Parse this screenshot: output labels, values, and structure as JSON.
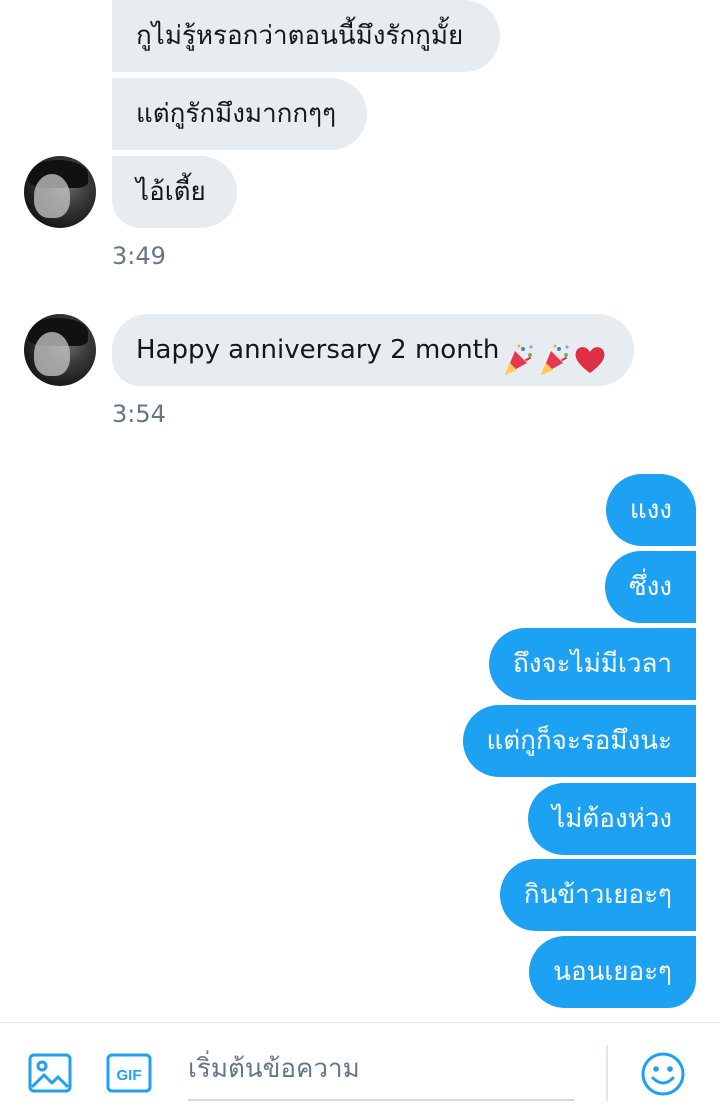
{
  "messages": {
    "incoming": [
      {
        "text": "กูไม่รู้หรอกว่าตอนนี้มึงรักกูมั้ย"
      },
      {
        "text": "แต่กูรักมึงมากกๆๆ"
      },
      {
        "text": "ไอ้เตี้ย"
      },
      {
        "text": "Happy anniversary 2 month"
      }
    ],
    "incoming_emojis": [
      "party-popper",
      "party-popper",
      "red-heart"
    ],
    "timestamps": [
      "3:49",
      "3:54"
    ],
    "outgoing": [
      {
        "text": "แงง"
      },
      {
        "text": "ซึ่งง"
      },
      {
        "text": "ถึงจะไม่มีเวลา"
      },
      {
        "text": "แต่กูก็จะรอมึงนะ"
      },
      {
        "text": "ไม่ต้องห่วง"
      },
      {
        "text": "กินข้าวเยอะๆ"
      },
      {
        "text": "นอนเยอะๆ"
      }
    ]
  },
  "composer": {
    "placeholder": "เริ่มต้นข้อความ",
    "gif_label": "GIF",
    "icons": [
      "image-icon",
      "gif-icon",
      "emoji-icon"
    ]
  },
  "colors": {
    "accent": "#1da1f2",
    "incoming_bubble": "#e6ecf0",
    "timestamp": "#657786",
    "heart": "#e0245e"
  }
}
